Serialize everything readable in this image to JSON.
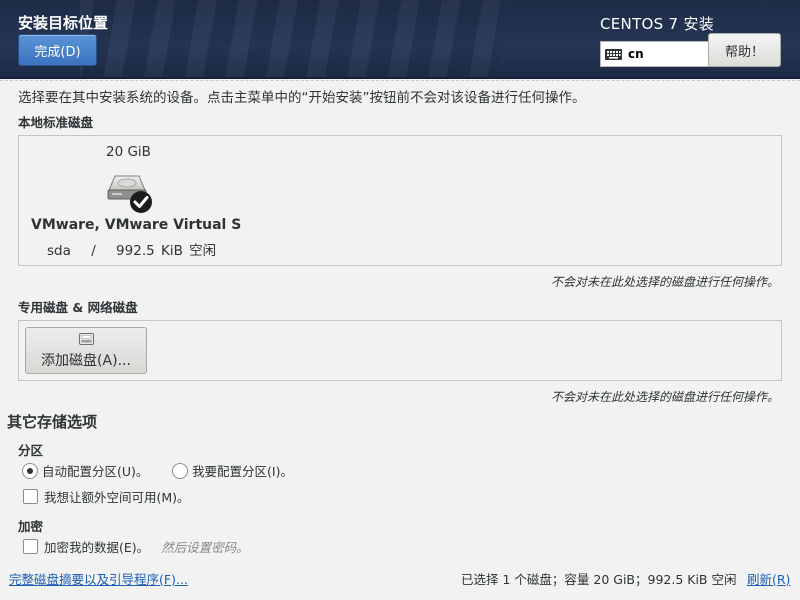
{
  "header": {
    "spoke_title": "安装目标位置",
    "done_label": "完成(D)",
    "product_title": "CENTOS 7 安装",
    "keyboard_layout": "cn",
    "help_label": "帮助！"
  },
  "intro": "选择要在其中安装系统的设备。点击主菜单中的“开始安装”按钮前不会对该设备进行任何操作。",
  "local_disks": {
    "label": "本地标准磁盘",
    "disk": {
      "size": "20 GiB",
      "name": "VMware, VMware Virtual S",
      "device": "sda",
      "separator": "/",
      "free": "992.5 KiB 空闲",
      "selected": true
    },
    "hint": "不会对未在此处选择的磁盘进行任何操作。"
  },
  "special_disks": {
    "label": "专用磁盘 & 网络磁盘",
    "add_disk_label": "添加磁盘(A)...",
    "hint": "不会对未在此处选择的磁盘进行任何操作。"
  },
  "other_options": {
    "title": "其它存储选项",
    "partitioning": {
      "label": "分区",
      "auto_label": "自动配置分区(U)。",
      "manual_label": "我要配置分区(I)。",
      "selected": "auto",
      "extra_space_label": "我想让额外空间可用(M)。",
      "extra_space_checked": false
    },
    "encryption": {
      "label": "加密",
      "encrypt_label": "加密我的数据(E)。",
      "encrypt_checked": false,
      "later_label": "然后设置密码。"
    }
  },
  "footer": {
    "summary_link": "完整磁盘摘要以及引导程序(F)...",
    "summary": "已选择 1 个磁盘；容量 20 GiB；992.5 KiB 空闲",
    "refresh_link": "刷新(R)"
  },
  "colors": {
    "header_bg": "#243555",
    "done_button": "#4a84cb",
    "link": "#1a5fb4"
  }
}
